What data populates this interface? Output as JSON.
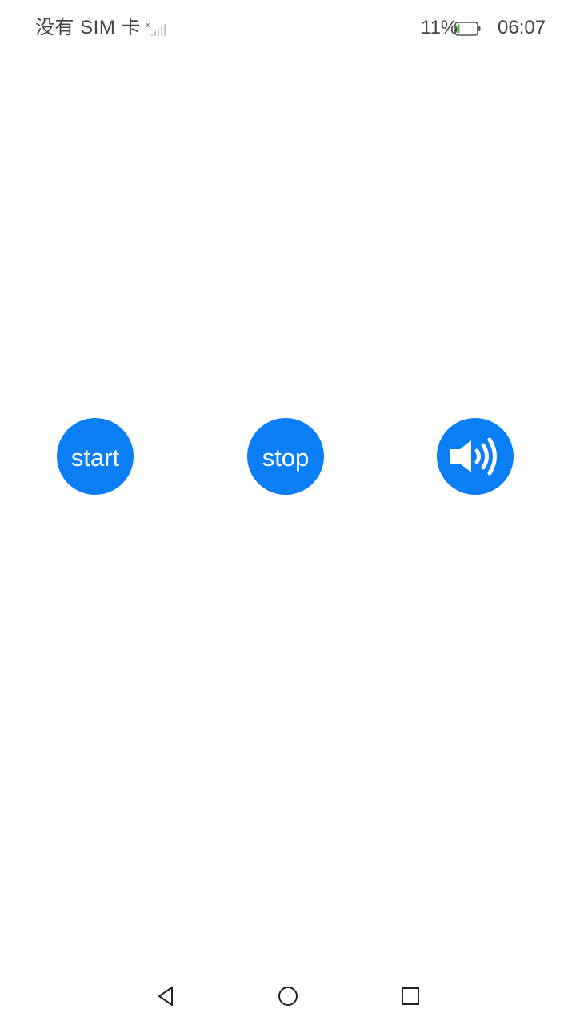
{
  "status_bar": {
    "carrier": "没有 SIM 卡",
    "signal_icon": "signal-no-service-icon",
    "battery_percent": "11%",
    "battery_icon": "battery-low-icon",
    "time": "06:07"
  },
  "controls": {
    "start_label": "start",
    "stop_label": "stop",
    "volume_icon": "speaker-volume-icon",
    "accent_color": "#0a7ff5"
  },
  "nav_bar": {
    "back_icon": "back-triangle-icon",
    "home_icon": "home-circle-icon",
    "recent_icon": "recent-apps-square-icon"
  }
}
